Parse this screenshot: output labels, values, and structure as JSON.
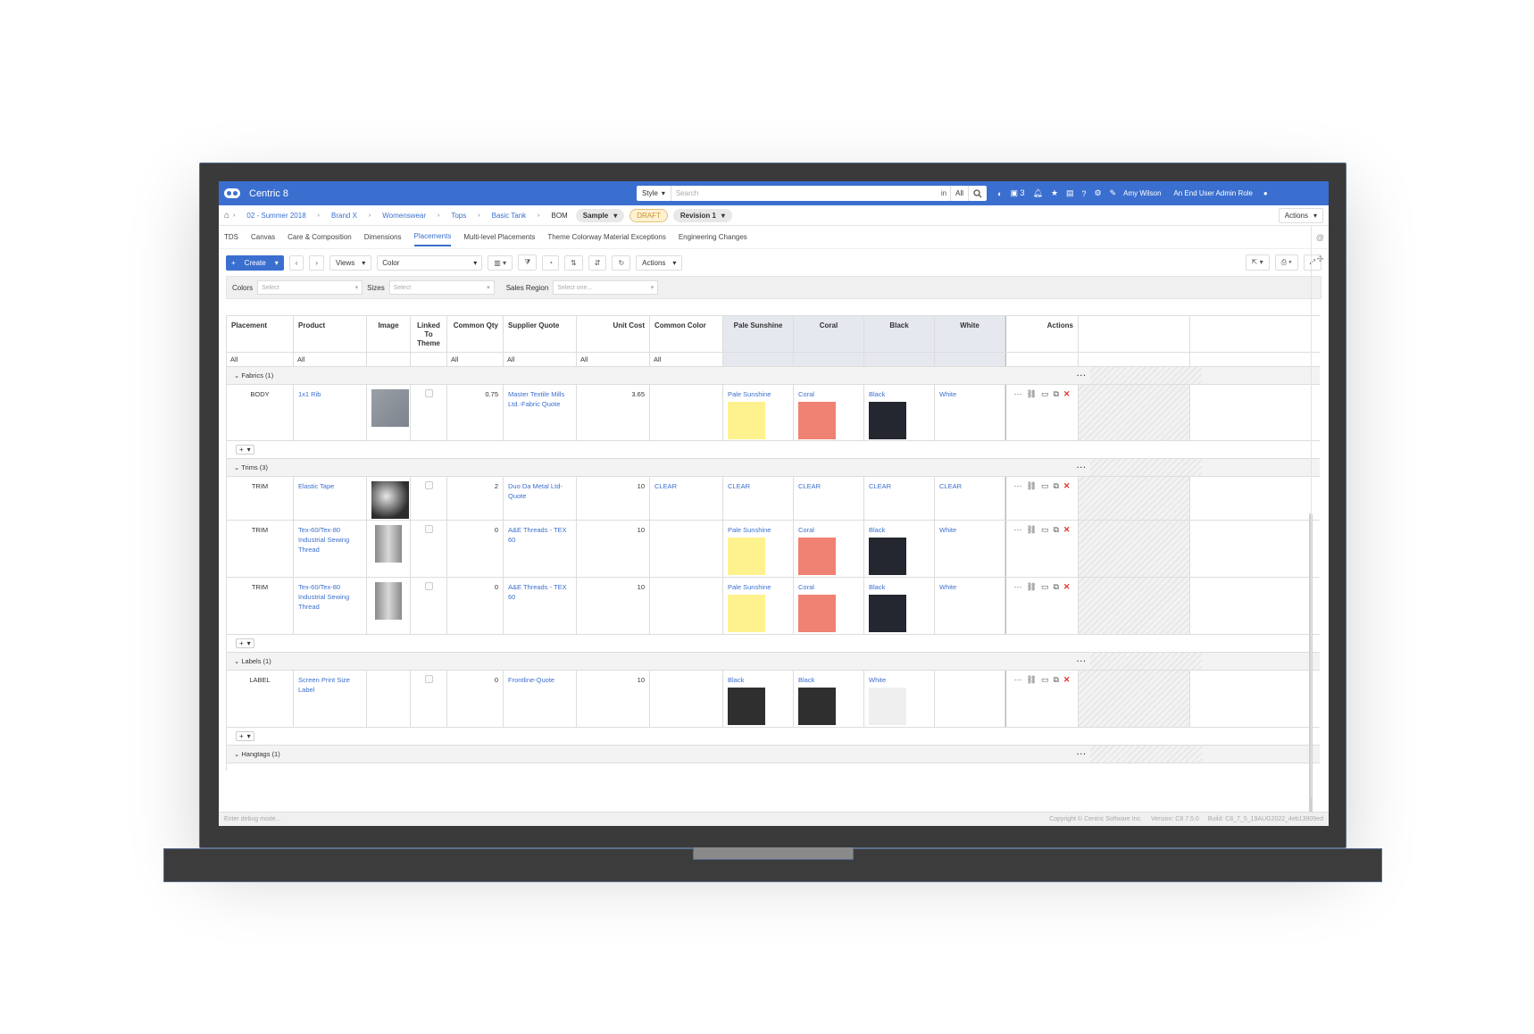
{
  "app": {
    "name": "Centric 8"
  },
  "search": {
    "scope": "Style",
    "placeholder": "Search",
    "in_label": "in",
    "all_label": "All"
  },
  "topbar": {
    "notif_count": "3",
    "user_name": "Amy Wilson",
    "user_role": "An End User Admin Role"
  },
  "breadcrumb": {
    "items": [
      "02 - Summer 2018",
      "Brand X",
      "Womenswear",
      "Tops",
      "Basic Tank"
    ],
    "current": "BOM",
    "sample_label": "Sample",
    "status": "DRAFT",
    "revision": "Revision 1",
    "actions": "Actions"
  },
  "tabs": [
    "TDS",
    "Canvas",
    "Care & Composition",
    "Dimensions",
    "Placements",
    "Multi-level Placements",
    "Theme Colorway Material Exceptions",
    "Engineering Changes"
  ],
  "toolbar": {
    "create": "Create",
    "views": "Views",
    "view_select": "Color",
    "actions": "Actions"
  },
  "filters": {
    "colors_label": "Colors",
    "colors_placeholder": "Select",
    "sizes_label": "Sizes",
    "sizes_placeholder": "Select",
    "region_label": "Sales Region",
    "region_placeholder": "Select one..."
  },
  "columns": {
    "placement": "Placement",
    "product": "Product",
    "image": "Image",
    "linked": "Linked To Theme",
    "common_qty": "Common Qty",
    "supplier_quote": "Supplier Quote",
    "unit_cost": "Unit Cost",
    "common_color": "Common Color",
    "c1": "Pale Sunshine",
    "c2": "Coral",
    "c3": "Black",
    "c4": "White",
    "actions": "Actions"
  },
  "filter_row": {
    "placement": "All",
    "product": "All",
    "common_qty": "All",
    "supplier_quote": "All",
    "unit_cost": "All",
    "common_color": "All"
  },
  "colors": {
    "pale_sunshine": "#fdf28e",
    "coral": "#ef8272",
    "black": "#242630",
    "label_black": "#2f2f2f",
    "white": "#efefef",
    "accent": "#3b6fcf"
  },
  "groups": {
    "fabrics": {
      "title": "Fabrics (1)",
      "rows": [
        {
          "placement": "BODY",
          "product": "1x1 Rib",
          "qty": "0.75",
          "quote": "Master Textile Mills Ltd.-Fabric Quote",
          "cost": "3.65",
          "common_color": "",
          "c1": "Pale Sunshine",
          "c2": "Coral",
          "c3": "Black",
          "c4": "White"
        }
      ]
    },
    "trims": {
      "title": "Trims (3)",
      "rows": [
        {
          "placement": "TRIM",
          "product": "Elastic Tape",
          "qty": "2",
          "quote": "Duo Da Metal Ltd-Quote",
          "cost": "10",
          "common_color": "CLEAR",
          "c1": "CLEAR",
          "c2": "CLEAR",
          "c3": "CLEAR",
          "c4": "CLEAR"
        },
        {
          "placement": "TRIM",
          "product": "Tex-60/Tex-80 Industrial Sewing Thread",
          "qty": "0",
          "quote": "A&E Threads - TEX 60",
          "cost": "10",
          "common_color": "",
          "c1": "Pale Sunshine",
          "c2": "Coral",
          "c3": "Black",
          "c4": "White"
        },
        {
          "placement": "TRIM",
          "product": "Tex-60/Tex-80 Industrial Sewing Thread",
          "qty": "0",
          "quote": "A&E Threads - TEX 60",
          "cost": "10",
          "common_color": "",
          "c1": "Pale Sunshine",
          "c2": "Coral",
          "c3": "Black",
          "c4": "White"
        }
      ]
    },
    "labels": {
      "title": "Labels (1)",
      "rows": [
        {
          "placement": "LABEL",
          "product": "Screen Print Size Label",
          "qty": "0",
          "quote": "Frontline-Quote",
          "cost": "10",
          "common_color": "",
          "c1": "Black",
          "c2": "Black",
          "c3": "White",
          "c4": ""
        }
      ]
    },
    "hangtags": {
      "title": "Hangtags (1)"
    }
  },
  "footer": {
    "debug": "Enter debug mode...",
    "copyright": "Copyright © Centric Software Inc.",
    "version": "Version: C8 7.5.0",
    "build": "Build: C8_7_5_19AUG2022_4eb13909ed"
  }
}
